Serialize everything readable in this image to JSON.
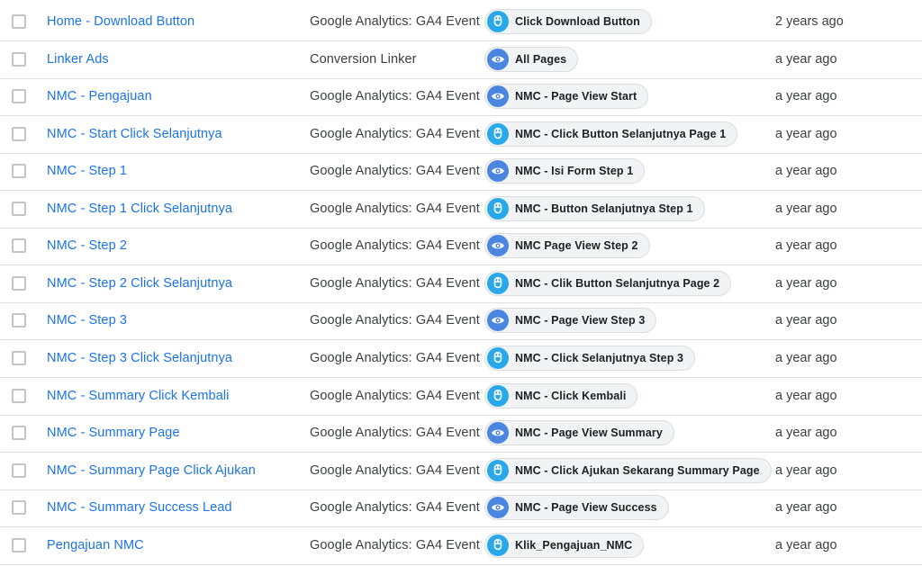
{
  "tags": [
    {
      "name": "Home - Download Button",
      "type": "Google Analytics: GA4 Event",
      "trigger": {
        "label": "Click Download Button",
        "icon": "cursor-click-icon"
      },
      "modified": "2 years ago"
    },
    {
      "name": "Linker Ads",
      "type": "Conversion Linker",
      "trigger": {
        "label": "All Pages",
        "icon": "eye-icon"
      },
      "modified": "a year ago"
    },
    {
      "name": "NMC - Pengajuan",
      "type": "Google Analytics: GA4 Event",
      "trigger": {
        "label": "NMC - Page View Start",
        "icon": "eye-icon"
      },
      "modified": "a year ago"
    },
    {
      "name": "NMC - Start Click Selanjutnya",
      "type": "Google Analytics: GA4 Event",
      "trigger": {
        "label": "NMC - Click Button Selanjutnya Page 1",
        "icon": "cursor-click-icon"
      },
      "modified": "a year ago"
    },
    {
      "name": "NMC - Step 1",
      "type": "Google Analytics: GA4 Event",
      "trigger": {
        "label": "NMC - Isi Form Step 1",
        "icon": "eye-icon"
      },
      "modified": "a year ago"
    },
    {
      "name": "NMC - Step 1 Click Selanjutnya",
      "type": "Google Analytics: GA4 Event",
      "trigger": {
        "label": "NMC - Button Selanjutnya Step 1",
        "icon": "cursor-click-icon"
      },
      "modified": "a year ago"
    },
    {
      "name": "NMC - Step 2",
      "type": "Google Analytics: GA4 Event",
      "trigger": {
        "label": "NMC Page View Step 2",
        "icon": "eye-icon"
      },
      "modified": "a year ago"
    },
    {
      "name": "NMC - Step 2 Click Selanjutnya",
      "type": "Google Analytics: GA4 Event",
      "trigger": {
        "label": "NMC - Clik Button Selanjutnya Page 2",
        "icon": "cursor-click-icon"
      },
      "modified": "a year ago"
    },
    {
      "name": "NMC - Step 3",
      "type": "Google Analytics: GA4 Event",
      "trigger": {
        "label": "NMC - Page View Step 3",
        "icon": "eye-icon"
      },
      "modified": "a year ago"
    },
    {
      "name": "NMC - Step 3 Click Selanjutnya",
      "type": "Google Analytics: GA4 Event",
      "trigger": {
        "label": "NMC - Click Selanjutnya Step 3",
        "icon": "cursor-click-icon"
      },
      "modified": "a year ago"
    },
    {
      "name": "NMC - Summary Click Kembali",
      "type": "Google Analytics: GA4 Event",
      "trigger": {
        "label": "NMC - Click Kembali",
        "icon": "cursor-click-icon"
      },
      "modified": "a year ago"
    },
    {
      "name": "NMC - Summary Page",
      "type": "Google Analytics: GA4 Event",
      "trigger": {
        "label": "NMC - Page View Summary",
        "icon": "eye-icon"
      },
      "modified": "a year ago"
    },
    {
      "name": "NMC - Summary Page Click Ajukan",
      "type": "Google Analytics: GA4 Event",
      "trigger": {
        "label": "NMC - Click Ajukan Sekarang Summary Page",
        "icon": "cursor-click-icon"
      },
      "modified": "a year ago"
    },
    {
      "name": "NMC - Summary Success Lead",
      "type": "Google Analytics: GA4 Event",
      "trigger": {
        "label": "NMC - Page View Success",
        "icon": "eye-icon"
      },
      "modified": "a year ago"
    },
    {
      "name": "Pengajuan NMC",
      "type": "Google Analytics: GA4 Event",
      "trigger": {
        "label": "Klik_Pengajuan_NMC",
        "icon": "cursor-click-icon"
      },
      "modified": "a year ago"
    }
  ],
  "colors": {
    "link": "#1a73e8",
    "click_trigger": "#29a9e9",
    "view_trigger": "#4a86e0"
  }
}
